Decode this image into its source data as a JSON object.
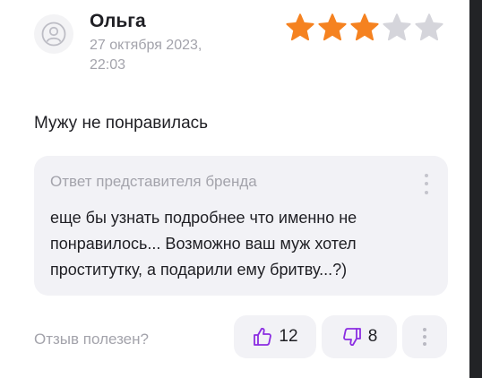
{
  "review": {
    "author": "Ольга",
    "date_line1": "27 октября 2023,",
    "date_line2": "22:03",
    "rating": 3,
    "rating_max": 5,
    "text": "Мужу не понравилась"
  },
  "reply": {
    "title": "Ответ представителя бренда",
    "text": "еще бы узнать подробнее что именно не понравилось... Возможно ваш муж хотел проститутку, а подарили ему бритву...?)"
  },
  "footer": {
    "helpful_label": "Отзыв полезен?",
    "likes": "12",
    "dislikes": "8"
  },
  "colors": {
    "star_filled": "#f58220",
    "star_empty": "#d5d5db",
    "accent": "#8b2de2",
    "muted_text": "#a3a3ab",
    "card_bg": "#f2f2f6"
  },
  "icons": {
    "avatar": "user-avatar-icon",
    "star": "star-icon",
    "more": "vertical-dots-icon",
    "like": "thumbs-up-icon",
    "dislike": "thumbs-down-icon"
  }
}
